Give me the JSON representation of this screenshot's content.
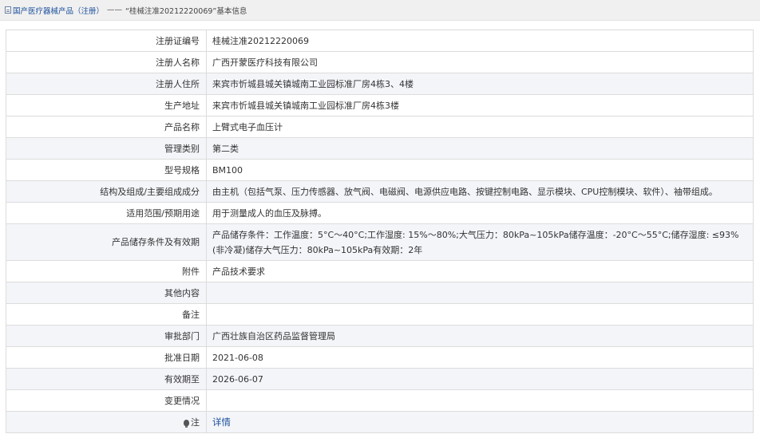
{
  "breadcrumb": {
    "root": "国产医疗器械产品（注册）",
    "separator": "——",
    "current": "“桂械注准20212220069”基本信息"
  },
  "rows": [
    {
      "label": "注册证编号",
      "value": "桂械注准20212220069"
    },
    {
      "label": "注册人名称",
      "value": "广西开蒙医疗科技有限公司"
    },
    {
      "label": "注册人住所",
      "value": "来宾市忻城县城关镇城南工业园标准厂房4栋3、4楼"
    },
    {
      "label": "生产地址",
      "value": "来宾市忻城县城关镇城南工业园标准厂房4栋3楼"
    },
    {
      "label": "产品名称",
      "value": "上臂式电子血压计"
    },
    {
      "label": "管理类别",
      "value": "第二类"
    },
    {
      "label": "型号规格",
      "value": "BM100"
    },
    {
      "label": "结构及组成/主要组成成分",
      "value": "由主机（包括气泵、压力传感器、放气阀、电磁阀、电源供应电路、按键控制电路、显示模块、CPU控制模块、软件）、袖带组成。"
    },
    {
      "label": "适用范围/预期用途",
      "value": "用于测量成人的血压及脉搏。"
    },
    {
      "label": "产品储存条件及有效期",
      "value": "产品储存条件：工作温度：5°C～40°C;工作湿度: 15%～80%;大气压力：80kPa~105kPa储存温度：-20°C～55°C;储存湿度: ≤93%(非冷凝)储存大气压力：80kPa~105kPa有效期：2年"
    },
    {
      "label": "附件",
      "value": "产品技术要求"
    },
    {
      "label": "其他内容",
      "value": ""
    },
    {
      "label": "备注",
      "value": ""
    },
    {
      "label": "审批部门",
      "value": "广西壮族自治区药品监督管理局"
    },
    {
      "label": "批准日期",
      "value": "2021-06-08"
    },
    {
      "label": "有效期至",
      "value": "2026-06-07"
    },
    {
      "label": "变更情况",
      "value": ""
    }
  ],
  "note": {
    "label": "注",
    "link": "详情"
  },
  "colors": {
    "link": "#1a4e9a",
    "row_alt": "#f4f5f9",
    "border": "#dcdcdc"
  }
}
